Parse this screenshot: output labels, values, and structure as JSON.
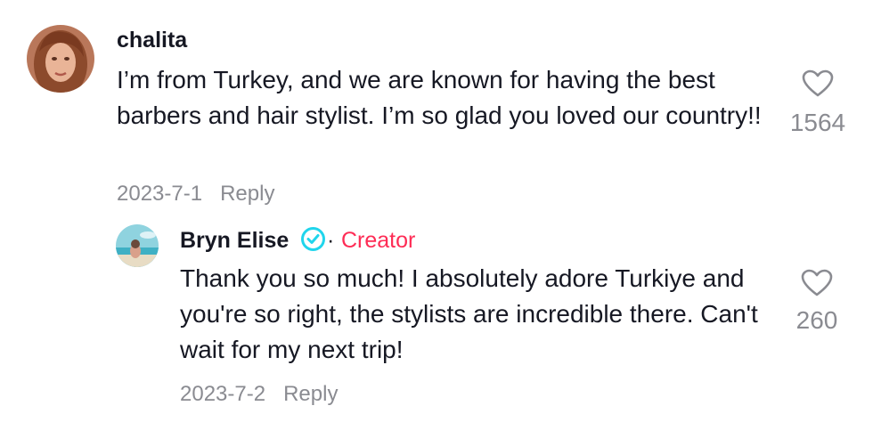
{
  "comment": {
    "username": "chalita",
    "text": "I’m from Turkey, and we are known for having the best barbers and hair stylist. I’m so glad you loved our country!!",
    "date": "2023-7-1",
    "reply_label": "Reply",
    "like_count": "1564",
    "avatar_icon": "user-avatar-photo"
  },
  "reply": {
    "username": "Bryn Elise",
    "verified_icon": "verified-check-icon",
    "separator": "·",
    "creator_label": "Creator",
    "text": "Thank you so much! I absolutely adore Turkiye and you're so right, the stylists are incredible there. Can't wait for my next trip!",
    "date": "2023-7-2",
    "reply_label": "Reply",
    "like_count": "260",
    "avatar_icon": "creator-avatar-photo"
  },
  "colors": {
    "text": "#161823",
    "secondary": "#8a8b91",
    "creator_accent": "#FE2C55",
    "verified": "#20D5EC"
  }
}
